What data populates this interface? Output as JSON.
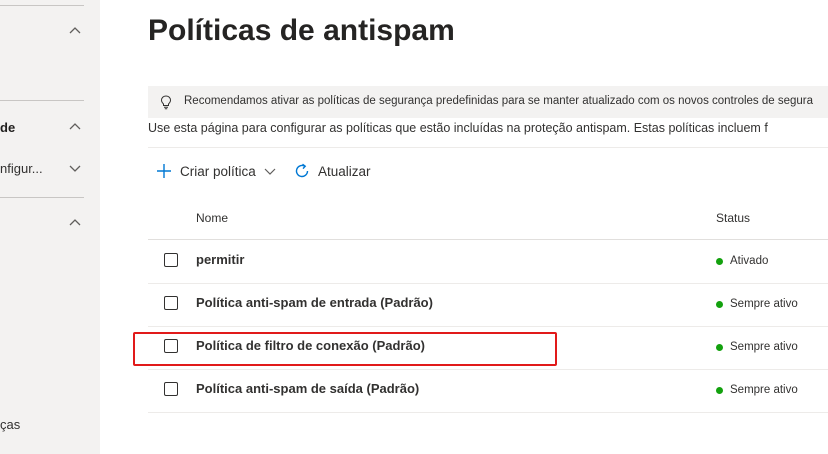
{
  "sidebar": {
    "item_de": "de",
    "item_configur": "nfigur...",
    "item_bottom": "ças"
  },
  "page": {
    "title": "Políticas de antispam",
    "banner_text": "Recomendamos ativar as políticas de segurança predefinidas para se manter atualizado com os novos controles de segura",
    "description": "Use esta página para configurar as políticas que estão incluídas na proteção antispam. Estas políticas incluem f"
  },
  "toolbar": {
    "create_label": "Criar política",
    "refresh_label": "Atualizar"
  },
  "table": {
    "columns": [
      "Nome",
      "Status"
    ],
    "rows": [
      {
        "name": "permitir",
        "status": "Ativado"
      },
      {
        "name": "Política anti-spam de entrada (Padrão)",
        "status": "Sempre ativo"
      },
      {
        "name": "Política de filtro de conexão (Padrão)",
        "status": "Sempre ativo"
      },
      {
        "name": "Política anti-spam de saída (Padrão)",
        "status": "Sempre ativo"
      }
    ]
  },
  "colors": {
    "status_green": "#13a10e",
    "highlight_red": "#e11a1a",
    "accent_blue": "#0078d4"
  },
  "icons": [
    "chevron-up-icon",
    "chevron-down-icon",
    "lightbulb-icon",
    "plus-icon",
    "refresh-icon"
  ]
}
